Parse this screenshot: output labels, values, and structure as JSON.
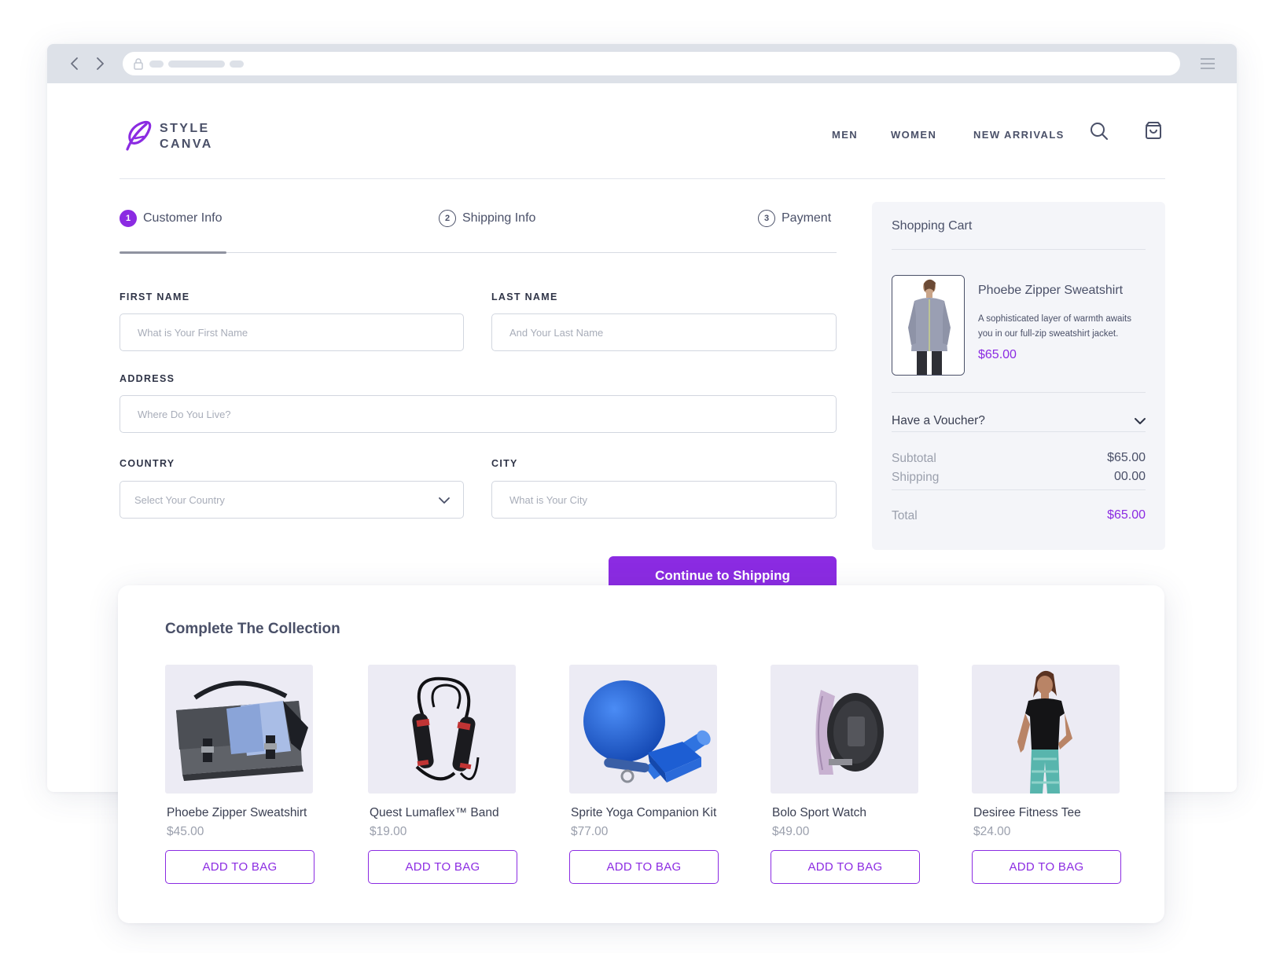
{
  "brand": {
    "line1": "STYLE",
    "line2": "CANVA"
  },
  "nav": {
    "men": "MEN",
    "women": "WOMEN",
    "new_arrivals": "NEW ARRIVALS"
  },
  "steps": [
    {
      "num": "1",
      "label": "Customer Info"
    },
    {
      "num": "2",
      "label": "Shipping Info"
    },
    {
      "num": "3",
      "label": "Payment"
    }
  ],
  "form": {
    "first_name": {
      "label": "FIRST NAME",
      "placeholder": "What is Your First Name"
    },
    "last_name": {
      "label": "LAST NAME",
      "placeholder": "And Your Last Name"
    },
    "address": {
      "label": "ADDRESS",
      "placeholder": "Where Do You Live?"
    },
    "country": {
      "label": "COUNTRY",
      "placeholder": "Select Your Country"
    },
    "city": {
      "label": "CITY",
      "placeholder": "What is Your City"
    },
    "continue": "Continue to Shipping"
  },
  "cart": {
    "title": "Shopping Cart",
    "item": {
      "name": "Phoebe Zipper Sweatshirt",
      "desc": "A sophisticated layer of warmth awaits you in our full-zip sweatshirt jacket.",
      "price": "$65.00"
    },
    "voucher": "Have a Voucher?",
    "subtotal_label": "Subtotal",
    "subtotal": "$65.00",
    "shipping_label": "Shipping",
    "shipping": "00.00",
    "total_label": "Total",
    "total": "$65.00"
  },
  "collection": {
    "title": "Complete The Collection",
    "add_label": "ADD TO BAG",
    "products": [
      {
        "name": "Phoebe Zipper Sweatshirt",
        "price": "$45.00"
      },
      {
        "name": "Quest Lumaflex™ Band",
        "price": "$19.00"
      },
      {
        "name": "Sprite Yoga Companion Kit",
        "price": "$77.00"
      },
      {
        "name": "Bolo Sport Watch",
        "price": "$49.00"
      },
      {
        "name": "Desiree Fitness Tee",
        "price": "$24.00"
      }
    ]
  },
  "colors": {
    "accent": "#8b2be2",
    "text": "#4a5068",
    "muted": "#9ba0ad"
  }
}
